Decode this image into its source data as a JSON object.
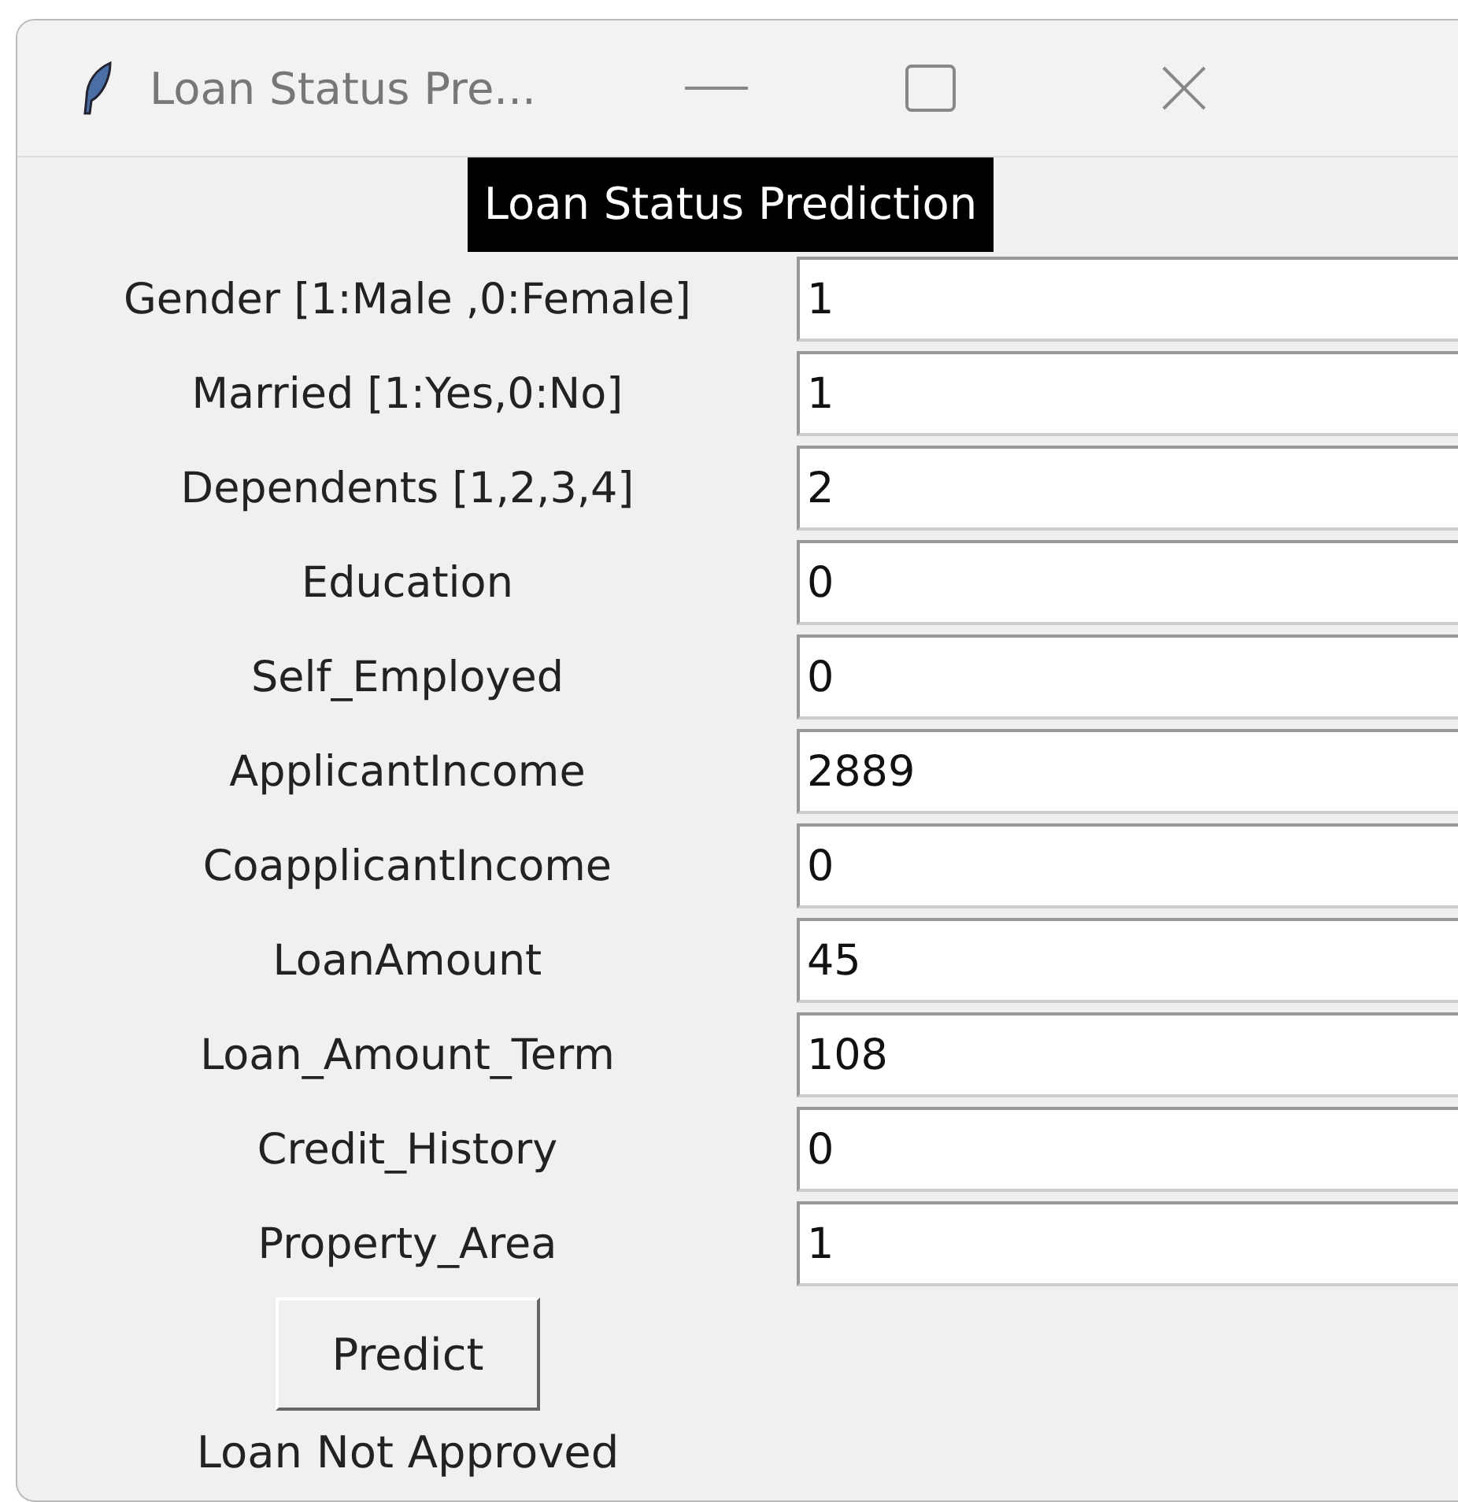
{
  "window": {
    "title": "Loan Status Pre..."
  },
  "header": "Loan Status Prediction",
  "fields": [
    {
      "label": "Gender [1:Male ,0:Female]",
      "value": "1"
    },
    {
      "label": "Married [1:Yes,0:No]",
      "value": "1"
    },
    {
      "label": "Dependents [1,2,3,4]",
      "value": "2"
    },
    {
      "label": "Education",
      "value": "0"
    },
    {
      "label": "Self_Employed",
      "value": "0"
    },
    {
      "label": "ApplicantIncome",
      "value": "2889"
    },
    {
      "label": "CoapplicantIncome",
      "value": "0"
    },
    {
      "label": "LoanAmount",
      "value": "45"
    },
    {
      "label": "Loan_Amount_Term",
      "value": "108"
    },
    {
      "label": "Credit_History",
      "value": "0"
    },
    {
      "label": "Property_Area",
      "value": "1"
    }
  ],
  "button": "Predict",
  "result": "Loan Not Approved"
}
